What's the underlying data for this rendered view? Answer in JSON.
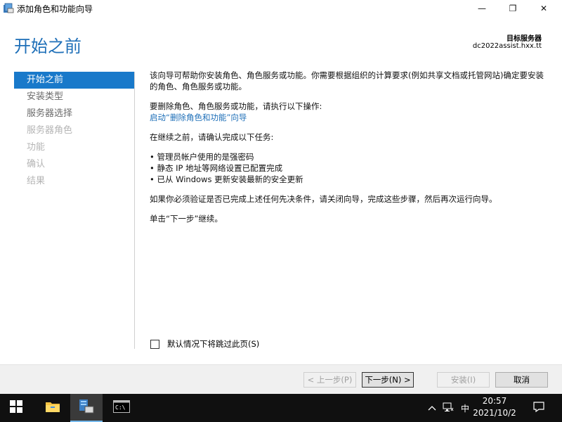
{
  "window": {
    "title": "添加角色和功能向导",
    "controls": {
      "minimize": "—",
      "maximize": "❐",
      "close": "✕"
    }
  },
  "header": {
    "page_title": "开始之前",
    "target_label": "目标服务器",
    "target_server": "dc2022assist.hxx.tt"
  },
  "nav": {
    "items": [
      {
        "label": "开始之前",
        "state": "active"
      },
      {
        "label": "安装类型",
        "state": "enabled"
      },
      {
        "label": "服务器选择",
        "state": "enabled"
      },
      {
        "label": "服务器角色",
        "state": "disabled"
      },
      {
        "label": "功能",
        "state": "disabled"
      },
      {
        "label": "确认",
        "state": "disabled"
      },
      {
        "label": "结果",
        "state": "disabled"
      }
    ]
  },
  "content": {
    "intro": "该向导可帮助你安装角色、角色服务或功能。你需要根据组织的计算要求(例如共享文档或托管网站)确定要安装的角色、角色服务或功能。",
    "remove_heading": "要删除角色、角色服务或功能，请执行以下操作:",
    "remove_link": "启动“删除角色和功能”向导",
    "before_heading": "在继续之前，请确认完成以下任务:",
    "tasks": [
      "管理员帐户使用的是强密码",
      "静态 IP 地址等网络设置已配置完成",
      "已从 Windows 更新安装最新的安全更新"
    ],
    "verify_note": "如果你必须验证是否已完成上述任何先决条件，请关闭向导，完成这些步骤，然后再次运行向导。",
    "continue_note": "单击“下一步”继续。"
  },
  "skip_checkbox": {
    "label": "默认情况下将跳过此页(S)",
    "checked": false
  },
  "buttons": {
    "prev": "< 上一步(P)",
    "next": "下一步(N) >",
    "install": "安装(I)",
    "cancel": "取消"
  },
  "taskbar": {
    "apps": [
      "start-icon",
      "file-explorer-icon",
      "server-manager-icon",
      "command-prompt-icon"
    ],
    "tray": {
      "ime": "中"
    },
    "clock": {
      "time": "20:57",
      "date": "2021/10/2"
    }
  },
  "colors": {
    "accent": "#1979ca",
    "title_blue": "#1e6fb8",
    "taskbar": "#101010"
  }
}
